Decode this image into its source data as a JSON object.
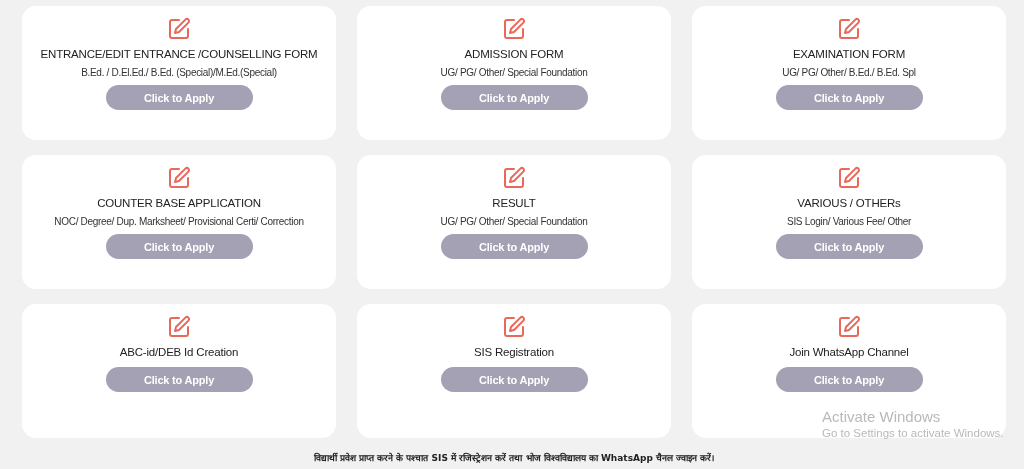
{
  "cards": [
    {
      "title": "ENTRANCE/EDIT ENTRANCE /COUNSELLING FORM",
      "subtitle": "B.Ed. / D.El.Ed./ B.Ed. (Special)/M.Ed.(Special)",
      "button": "Click to Apply"
    },
    {
      "title": "ADMISSION FORM",
      "subtitle": "UG/ PG/ Other/ Special Foundation",
      "button": "Click to Apply"
    },
    {
      "title": "EXAMINATION FORM",
      "subtitle": "UG/ PG/ Other/ B.Ed./ B.Ed. Spl",
      "button": "Click to Apply"
    },
    {
      "title": "COUNTER BASE APPLICATION",
      "subtitle": "NOC/ Degree/ Dup. Marksheet/ Provisional Certi/ Correction",
      "button": "Click to Apply"
    },
    {
      "title": "RESULT",
      "subtitle": "UG/ PG/ Other/ Special Foundation",
      "button": "Click to Apply"
    },
    {
      "title": "VARIOUS / OTHERs",
      "subtitle": "SIS Login/ Various Fee/ Other",
      "button": "Click to Apply"
    },
    {
      "title": "ABC-id/DEB Id Creation",
      "button": "Click to Apply"
    },
    {
      "title": "SIS Registration",
      "button": "Click to Apply"
    },
    {
      "title": "Join WhatsApp Channel",
      "button": "Click to Apply"
    }
  ],
  "notice": "विद्यार्थी प्रवेश प्राप्त करने के पश्चात SIS में रजिस्ट्रेशन करें तथा भोज विश्वविद्यालय का WhatsApp चैनल ज्वाइन करें।",
  "os_overlay": {
    "title": "Activate Windows",
    "subtitle": "Go to Settings to activate Windows."
  }
}
